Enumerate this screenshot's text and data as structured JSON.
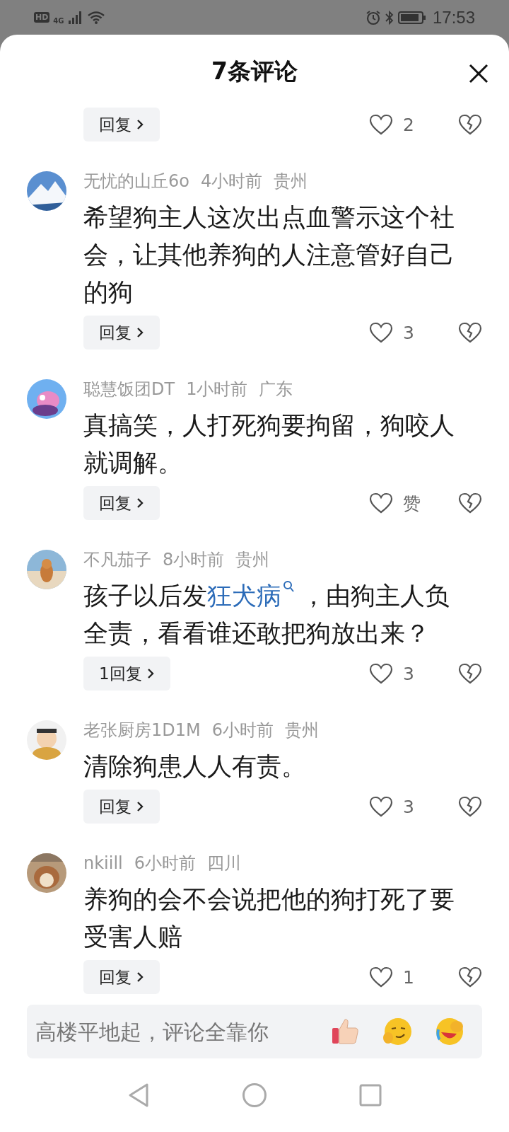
{
  "status_bar": {
    "network_badge": "HD",
    "network_type": "4G",
    "time": "17:53"
  },
  "sheet": {
    "title": "7条评论"
  },
  "comments": [
    {
      "reply": "回复",
      "likes": "2"
    },
    {
      "name": "无忧的山丘6o",
      "time": "4小时前",
      "location": "贵州",
      "body": [
        {
          "kind": "plain",
          "text": "希望狗主人这次出点血警示这个社会，让其他养狗的人注意管好自己的狗"
        }
      ],
      "reply": "回复",
      "likes": "3"
    },
    {
      "name": "聪慧饭团DT",
      "time": "1小时前",
      "location": "广东",
      "body": [
        {
          "kind": "plain",
          "text": "真搞笑，人打死狗要拘留，狗咬人就调解。"
        }
      ],
      "reply": "回复",
      "likes": "赞"
    },
    {
      "name": "不凡茄子",
      "time": "8小时前",
      "location": "贵州",
      "body": [
        {
          "kind": "plain",
          "text": "孩子以后发"
        },
        {
          "kind": "link",
          "text": "狂犬病"
        },
        {
          "kind": "plain",
          "text": "，由狗主人负全责，看看谁还敢把狗放出来？"
        }
      ],
      "reply": "1回复",
      "likes": "3"
    },
    {
      "name": "老张厨房1D1M",
      "time": "6小时前",
      "location": "贵州",
      "body": [
        {
          "kind": "plain",
          "text": "清除狗患人人有责。"
        }
      ],
      "reply": "回复",
      "likes": "3"
    },
    {
      "name": "nkiill",
      "time": "6小时前",
      "location": "四川",
      "body": [
        {
          "kind": "plain",
          "text": "养狗的会不会说把他的狗打死了要受害人赔"
        }
      ],
      "reply": "回复",
      "likes": "1"
    }
  ],
  "composer": {
    "placeholder": "高楼平地起，评论全靠你"
  }
}
